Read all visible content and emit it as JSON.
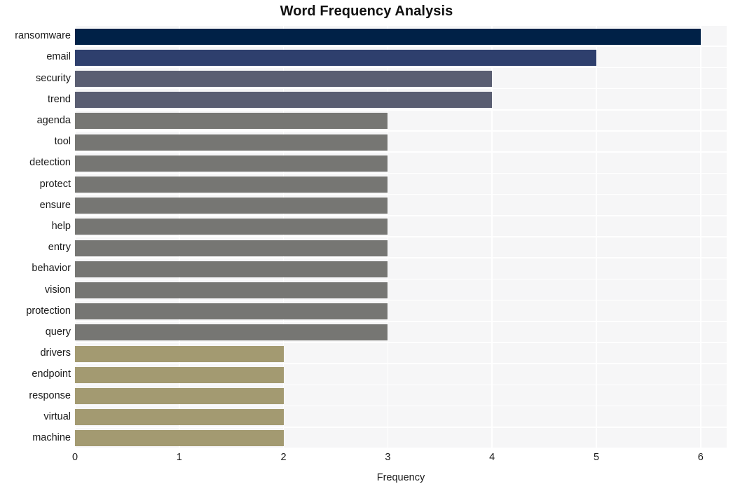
{
  "chart_data": {
    "type": "bar",
    "orientation": "horizontal",
    "title": "Word Frequency Analysis",
    "xlabel": "Frequency",
    "ylabel": "",
    "categories": [
      "ransomware",
      "email",
      "security",
      "trend",
      "agenda",
      "tool",
      "detection",
      "protect",
      "ensure",
      "help",
      "entry",
      "behavior",
      "vision",
      "protection",
      "query",
      "drivers",
      "endpoint",
      "response",
      "virtual",
      "machine"
    ],
    "values": [
      6,
      5,
      4,
      4,
      3,
      3,
      3,
      3,
      3,
      3,
      3,
      3,
      3,
      3,
      3,
      2,
      2,
      2,
      2,
      2
    ],
    "bar_colors": [
      "#002147",
      "#2e3f6d",
      "#5a5e72",
      "#5a5e72",
      "#767673",
      "#767673",
      "#767673",
      "#767673",
      "#767673",
      "#767673",
      "#767673",
      "#767673",
      "#767673",
      "#767673",
      "#767673",
      "#a39a71",
      "#a39a71",
      "#a39a71",
      "#a39a71",
      "#a39a71"
    ],
    "xlim": [
      0,
      6.25
    ],
    "xticks": [
      0,
      1,
      2,
      3,
      4,
      5,
      6
    ],
    "xtick_labels": [
      "0",
      "1",
      "2",
      "3",
      "4",
      "5",
      "6"
    ],
    "grid": true,
    "grid_color": "#ffffff",
    "plot_background": "#f6f6f7",
    "figure_background": "#ffffff",
    "legend": null
  }
}
